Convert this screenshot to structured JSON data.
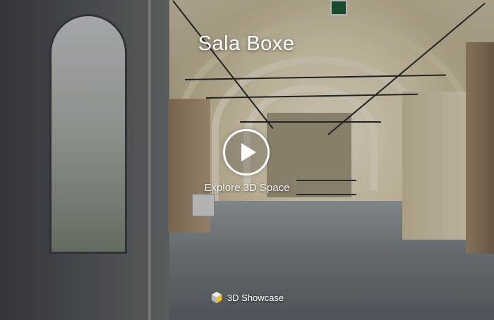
{
  "space": {
    "title": "Sala Boxe",
    "cta_label": "Explore 3D Space",
    "cta_action": "play"
  },
  "branding": {
    "label": "3D Showcase",
    "icon": "matterport-cube-icon"
  },
  "colors": {
    "overlay_text": "#ffffff",
    "cube_yellow": "#f5c21a",
    "cube_light": "#e9e9e9",
    "cube_gray": "#b8b8b8"
  }
}
